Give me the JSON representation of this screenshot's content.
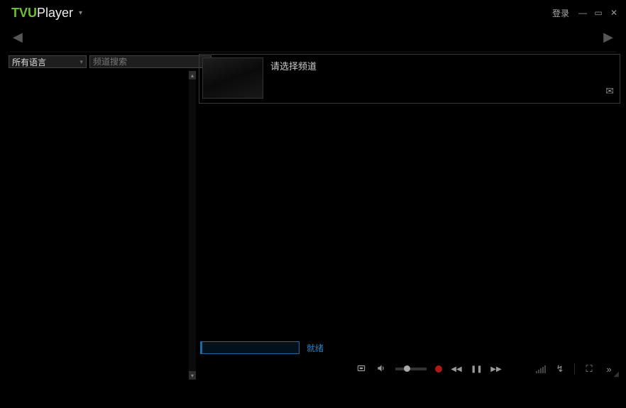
{
  "app": {
    "name1": "TVU",
    "name2": "Player"
  },
  "titlebar": {
    "login": "登录"
  },
  "sidebar": {
    "language_dropdown": "所有语言",
    "search_placeholder": "频道搜索"
  },
  "channel": {
    "prompt": "请选择频道"
  },
  "status": {
    "text": "就绪"
  },
  "icons": {
    "menu": "▾",
    "minimize": "—",
    "maximize": "▭",
    "close": "✕",
    "nav_left": "◀",
    "nav_right": "▶",
    "scroll_up": "▴",
    "scroll_down": "▾",
    "dropdown": "▾",
    "search": "⌕",
    "mail": "✉",
    "rewind": "◀◀",
    "pause": "❚❚",
    "forward": "▶▶",
    "refresh": "↯",
    "fullscreen": "⛶",
    "more": "»",
    "resize": "◢"
  }
}
